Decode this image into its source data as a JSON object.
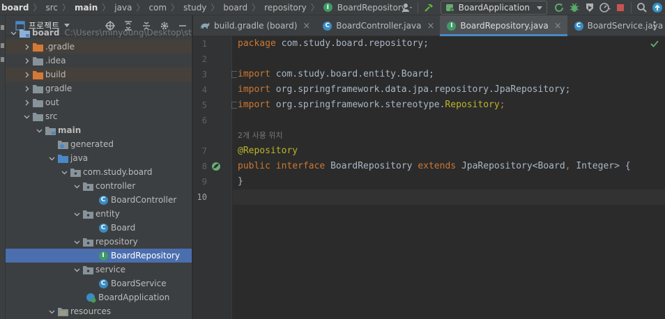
{
  "breadcrumb": {
    "items": [
      "board",
      "src",
      "main",
      "java",
      "com",
      "study",
      "board",
      "repository",
      "BoardRepository"
    ]
  },
  "toolbar": {
    "run_config": "BoardApplication"
  },
  "project_panel": {
    "title": "프로젝트"
  },
  "tree": {
    "root_label": "board",
    "root_path": "C:\\Users\\minyoung\\Desktop\\st",
    "gradle_hidden": ".gradle",
    "idea": ".idea",
    "build": "build",
    "gradle": "gradle",
    "out": "out",
    "src": "src",
    "main": "main",
    "generated": "generated",
    "java": "java",
    "package": "com.study.board",
    "controller": "controller",
    "board_controller": "BoardController",
    "entity": "entity",
    "board": "Board",
    "repository": "repository",
    "board_repository": "BoardRepository",
    "service": "service",
    "board_service": "BoardService",
    "board_application": "BoardApplication",
    "resources": "resources"
  },
  "tabs": [
    {
      "label": "build.gradle (board)"
    },
    {
      "label": "BoardController.java"
    },
    {
      "label": "BoardRepository.java"
    },
    {
      "label": "BoardService.java"
    }
  ],
  "editor": {
    "line_numbers": [
      "1",
      "2",
      "3",
      "4",
      "5",
      "6",
      "7",
      "8",
      "9",
      "10"
    ],
    "usage_hint": "2개 사용 위치",
    "code": {
      "l1_kw": "package",
      "l1_rest": " com.study.board.repository;",
      "l3_kw": "import",
      "l3_rest": " com.study.board.entity.Board;",
      "l4_kw": "import",
      "l4_rest": " org.springframework.data.jpa.repository.JpaRepository;",
      "l5_kw": "import",
      "l5_rest": " org.springframework.stereotype.",
      "l5_ann": "Repository",
      "l5_end": ";",
      "l7_ann": "@Repository",
      "l8_kw1": "public",
      "l8_kw2": "interface",
      "l8_name": "BoardRepository",
      "l8_kw3": "extends",
      "l8_type": "JpaRepository<Board",
      "l8_comma": ",",
      "l8_type2": "Integer> {",
      "l9": "}"
    }
  },
  "colors": {
    "keyword": "#cc7832",
    "annotation": "#bbb529",
    "text": "#a9b7c6",
    "selection": "#4b6eaf",
    "tab_underline": "#4a88c7"
  }
}
